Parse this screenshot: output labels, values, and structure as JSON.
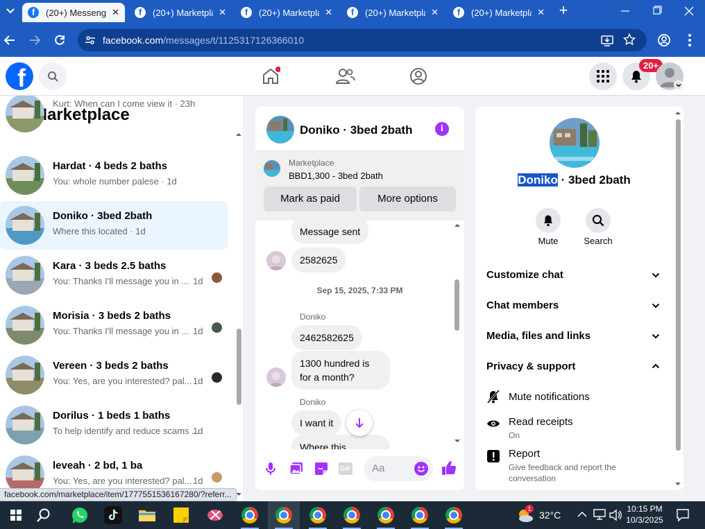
{
  "browser": {
    "tabs": [
      {
        "title": "(20+) Messenger",
        "active": true
      },
      {
        "title": "(20+) Marketplace",
        "active": false
      },
      {
        "title": "(20+) Marketplace",
        "active": false
      },
      {
        "title": "(20+) Marketplace",
        "active": false
      },
      {
        "title": "(20+) Marketplace",
        "active": false
      }
    ],
    "url_domain": "facebook.com",
    "url_path": "/messages/t/1125317126366010",
    "status_url": "facebook.com/marketplace/item/1777551536167280/?referr..."
  },
  "fb_header": {
    "notification_badge": "20+"
  },
  "left_panel": {
    "title": "Marketplace",
    "conversations": [
      {
        "name": "",
        "preview": "Kurt: When can I come view it",
        "time": "23h",
        "avatar_color": "#8a9a6a"
      },
      {
        "name": "Hardat · 4 beds 2 baths",
        "preview": "You: whole number palese",
        "time": "1d",
        "avatar_color": "#6c8f5a"
      },
      {
        "name": "Doniko · 3bed 2bath",
        "preview": "Where this located",
        "time": "1d",
        "avatar_color": "#4e9ac4",
        "selected": true
      },
      {
        "name": "Kara · 3 beds 2.5 baths",
        "preview": "You: Thanks I'll message you in ...",
        "time": "1d",
        "avatar_color": "#9aa7b4"
      },
      {
        "name": "Morisia · 3 beds 2 baths",
        "preview": "You: Thanks I'll message you in ...",
        "time": "1d",
        "avatar_color": "#7d8a6e"
      },
      {
        "name": "Vereen · 3 beds 2 baths",
        "preview": "You: Yes, are you interested? pal...",
        "time": "1d",
        "avatar_color": "#8f8c6a"
      },
      {
        "name": "Dorilus · 1 beds 1 baths",
        "preview": "To help identify and reduce scams ...",
        "time": "1d",
        "avatar_color": "#7ea1b0"
      },
      {
        "name": "leveah · 2 bd, 1 ba",
        "preview": "You: Yes, are you interested? pal...",
        "time": "1d",
        "avatar_color": "#b56a6a"
      }
    ]
  },
  "chat": {
    "title": "Doniko · 3bed 2bath",
    "listing_label": "Marketplace",
    "listing_title": "BBD1,300 - 3bed 2bath",
    "mark_paid_label": "Mark as paid",
    "more_options_label": "More options",
    "messages": [
      {
        "text": "Message sent"
      },
      {
        "text": "2582625"
      },
      {
        "text": "Sep 15, 2025, 7:33 PM"
      },
      {
        "text": "Doniko"
      },
      {
        "text": "2462582625"
      },
      {
        "text": "1300 hundred is for a month?"
      },
      {
        "text": "Doniko"
      },
      {
        "text": "I want it"
      },
      {
        "text": "Where this"
      }
    ],
    "composer_placeholder": "Aa",
    "gif_label": "GIF"
  },
  "details": {
    "name_highlight": "Doniko",
    "name_rest": " · 3bed 2bath",
    "mute_label": "Mute",
    "search_label": "Search",
    "sections": [
      {
        "label": "Customize chat",
        "expanded": false
      },
      {
        "label": "Chat members",
        "expanded": false
      },
      {
        "label": "Media, files and links",
        "expanded": false
      },
      {
        "label": "Privacy & support",
        "expanded": true
      }
    ],
    "mute_notifications_label": "Mute notifications",
    "read_receipts_label": "Read receipts",
    "read_receipts_value": "On",
    "report_label": "Report",
    "report_sub": "Give feedback and report the conversation"
  },
  "taskbar": {
    "weather_badge": "1",
    "temperature": "32°C",
    "time": "10:15 PM",
    "date": "10/3/2025"
  },
  "colors": {
    "fb_blue": "#1877f2",
    "chrome_blue": "#1e5cc1",
    "accent_purple": "#a033ff",
    "badge_red": "#e41e3f"
  }
}
